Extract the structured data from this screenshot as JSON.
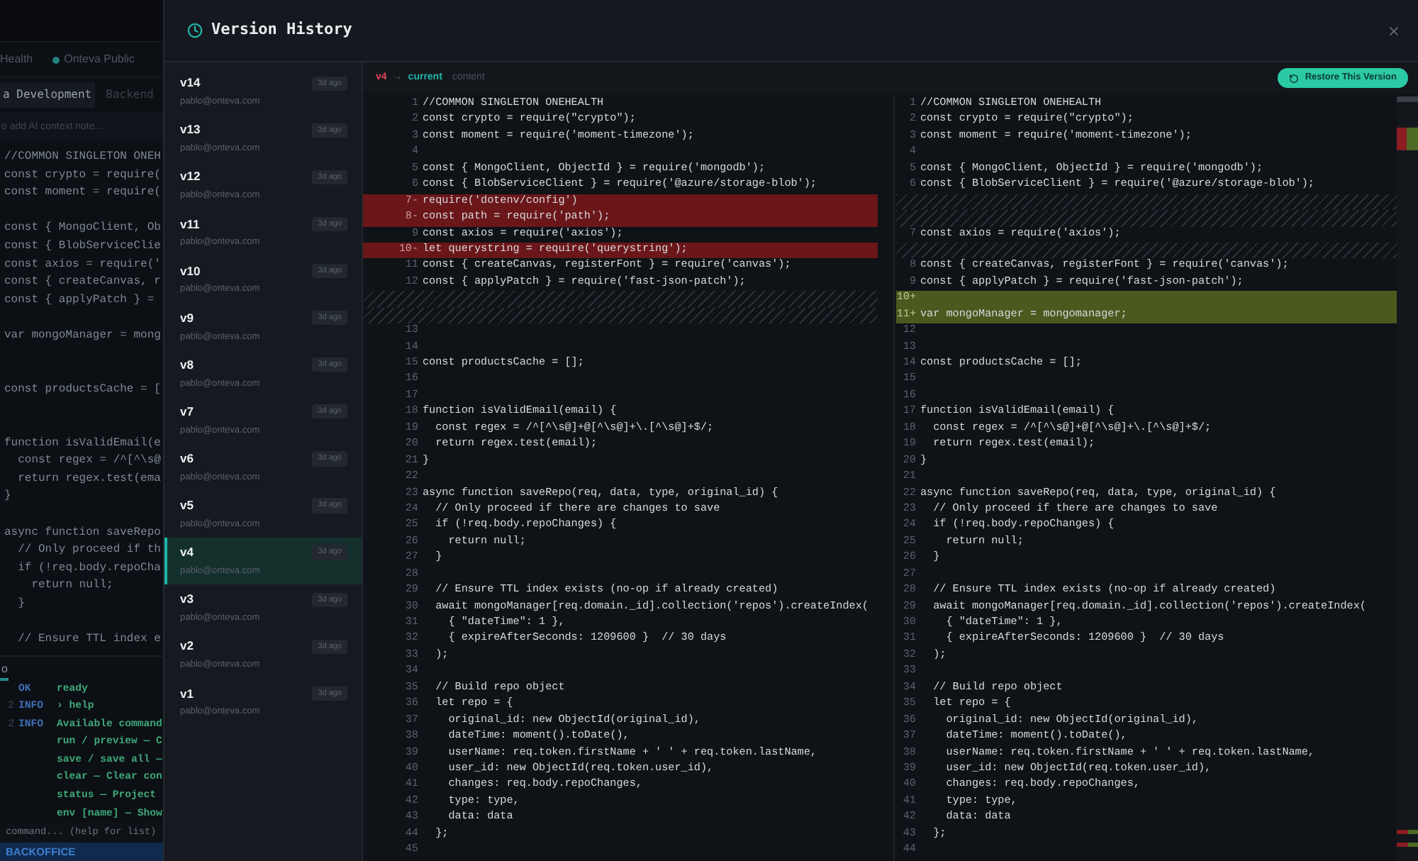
{
  "background_app": {
    "tabs": [
      {
        "label": "Health",
        "dot": false
      },
      {
        "label": "Onteva Public",
        "dot": true
      }
    ],
    "subtabs": [
      {
        "label": "a Development",
        "selected": true
      },
      {
        "label": "Backend",
        "selected": false
      }
    ],
    "note_field": {
      "placeholder": "o add AI context note..."
    },
    "editor_lines": [
      {
        "kind": "code",
        "text": "//COMMON SINGLETON ONEH"
      },
      {
        "kind": "code",
        "text": "const crypto = require("
      },
      {
        "kind": "code",
        "text": "const moment = require("
      },
      {
        "kind": "blank"
      },
      {
        "kind": "code",
        "text": "const { MongoClient, Ob"
      },
      {
        "kind": "code",
        "text": "const { BlobServiceClie"
      },
      {
        "kind": "code",
        "text": "const axios = require('"
      },
      {
        "kind": "code",
        "text": "const { createCanvas, r"
      },
      {
        "kind": "code",
        "text": "const { applyPatch } ="
      },
      {
        "kind": "blank"
      },
      {
        "kind": "code",
        "text": "var mongoManager = mong"
      },
      {
        "kind": "blank"
      },
      {
        "kind": "blank"
      },
      {
        "kind": "code",
        "text": "const productsCache = ["
      },
      {
        "kind": "blank"
      },
      {
        "kind": "blank"
      },
      {
        "kind": "code",
        "text": "function isValidEmail(e"
      },
      {
        "kind": "code",
        "text": "  const regex = /^[^\\s@"
      },
      {
        "kind": "code",
        "text": "  return regex.test(ema"
      },
      {
        "kind": "code",
        "text": "}"
      },
      {
        "kind": "blank"
      },
      {
        "kind": "code",
        "text": "async function saveRepo"
      },
      {
        "kind": "code",
        "text": "  // Only proceed if th"
      },
      {
        "kind": "code",
        "text": "  if (!req.body.repoCha"
      },
      {
        "kind": "code",
        "text": "    return null;"
      },
      {
        "kind": "code",
        "text": "  }"
      },
      {
        "kind": "blank"
      },
      {
        "kind": "code",
        "text": "  // Ensure TTL index e"
      }
    ],
    "terminal_tab": "o",
    "terminal_lines": [
      {
        "level": "OK",
        "text": "ready"
      },
      {
        "number": "2",
        "level": "INFO",
        "text": "› help"
      },
      {
        "number": "2",
        "level": "INFO",
        "text": "Available command"
      },
      {
        "text": "run / preview — C"
      },
      {
        "text": "save / save all —"
      },
      {
        "text": "clear — Clear con"
      },
      {
        "text": "status — Project"
      },
      {
        "text": "env [name] — Show"
      }
    ],
    "command_field": {
      "placeholder": " command... (help for list)"
    },
    "status_bar": "BACKOFFICE"
  },
  "dialog": {
    "title": "Version History",
    "versions": [
      {
        "label": "v14",
        "author": "pablo@onteva.com",
        "age": "3d ago",
        "selected": false
      },
      {
        "label": "v13",
        "author": "pablo@onteva.com",
        "age": "3d ago",
        "selected": false
      },
      {
        "label": "v12",
        "author": "pablo@onteva.com",
        "age": "3d ago",
        "selected": false
      },
      {
        "label": "v11",
        "author": "pablo@onteva.com",
        "age": "3d ago",
        "selected": false
      },
      {
        "label": "v10",
        "author": "pablo@onteva.com",
        "age": "3d ago",
        "selected": false
      },
      {
        "label": "v9",
        "author": "pablo@onteva.com",
        "age": "3d ago",
        "selected": false
      },
      {
        "label": "v8",
        "author": "pablo@onteva.com",
        "age": "3d ago",
        "selected": false
      },
      {
        "label": "v7",
        "author": "pablo@onteva.com",
        "age": "3d ago",
        "selected": false
      },
      {
        "label": "v6",
        "author": "pablo@onteva.com",
        "age": "3d ago",
        "selected": false
      },
      {
        "label": "v5",
        "author": "pablo@onteva.com",
        "age": "3d ago",
        "selected": false
      },
      {
        "label": "v4",
        "author": "pablo@onteva.com",
        "age": "3d ago",
        "selected": true
      },
      {
        "label": "v3",
        "author": "pablo@onteva.com",
        "age": "3d ago",
        "selected": false
      },
      {
        "label": "v2",
        "author": "pablo@onteva.com",
        "age": "3d ago",
        "selected": false
      },
      {
        "label": "v1",
        "author": "pablo@onteva.com",
        "age": "3d ago",
        "selected": false
      }
    ],
    "diff_header": {
      "from": "v4",
      "arrow": "→",
      "to": "current",
      "field": "content"
    },
    "restore_button": "Restore This Version",
    "left_pane": [
      {
        "kind": "normal",
        "number": "1",
        "code": "//COMMON SINGLETON ONEHEALTH"
      },
      {
        "kind": "normal",
        "number": "2",
        "code": "const crypto = require(\"crypto\");"
      },
      {
        "kind": "normal",
        "number": "3",
        "code": "const moment = require('moment-timezone');"
      },
      {
        "kind": "normal",
        "number": "4"
      },
      {
        "kind": "normal",
        "number": "5",
        "code": "const { MongoClient, ObjectId } = require('mongodb');"
      },
      {
        "kind": "normal",
        "number": "6",
        "code": "const { BlobServiceClient } = require('@azure/storage-blob');"
      },
      {
        "kind": "removed",
        "number": "7",
        "sign": "-",
        "code": "require('dotenv/config')"
      },
      {
        "kind": "removed",
        "number": "8",
        "sign": "-",
        "code": "const path = require('path');"
      },
      {
        "kind": "normal",
        "number": "9",
        "code": "const axios = require('axios');"
      },
      {
        "kind": "removed",
        "number": "10",
        "sign": "-",
        "code": "let querystring = require('querystring');"
      },
      {
        "kind": "normal",
        "number": "11",
        "code": "const { createCanvas, registerFont } = require('canvas');"
      },
      {
        "kind": "normal",
        "number": "12",
        "code": "const { applyPatch } = require('fast-json-patch');"
      },
      {
        "kind": "filler"
      },
      {
        "kind": "filler"
      },
      {
        "kind": "normal",
        "number": "13"
      },
      {
        "kind": "normal",
        "number": "14"
      },
      {
        "kind": "normal",
        "number": "15",
        "code": "const productsCache = [];"
      },
      {
        "kind": "normal",
        "number": "16"
      },
      {
        "kind": "normal",
        "number": "17"
      },
      {
        "kind": "normal",
        "number": "18",
        "code": "function isValidEmail(email) {"
      },
      {
        "kind": "normal",
        "number": "19",
        "code": "  const regex = /^[^\\s@]+@[^\\s@]+\\.[^\\s@]+$/;"
      },
      {
        "kind": "normal",
        "number": "20",
        "code": "  return regex.test(email);"
      },
      {
        "kind": "normal",
        "number": "21",
        "code": "}"
      },
      {
        "kind": "normal",
        "number": "22"
      },
      {
        "kind": "normal",
        "number": "23",
        "code": "async function saveRepo(req, data, type, original_id) {"
      },
      {
        "kind": "normal",
        "number": "24",
        "code": "  // Only proceed if there are changes to save"
      },
      {
        "kind": "normal",
        "number": "25",
        "code": "  if (!req.body.repoChanges) {"
      },
      {
        "kind": "normal",
        "number": "26",
        "code": "    return null;"
      },
      {
        "kind": "normal",
        "number": "27",
        "code": "  }"
      },
      {
        "kind": "normal",
        "number": "28"
      },
      {
        "kind": "normal",
        "number": "29",
        "code": "  // Ensure TTL index exists (no-op if already created)"
      },
      {
        "kind": "normal",
        "number": "30",
        "code": "  await mongoManager[req.domain._id].collection('repos').createIndex("
      },
      {
        "kind": "normal",
        "number": "31",
        "code": "    { \"dateTime\": 1 },"
      },
      {
        "kind": "normal",
        "number": "32",
        "code": "    { expireAfterSeconds: 1209600 }  // 30 days"
      },
      {
        "kind": "normal",
        "number": "33",
        "code": "  );"
      },
      {
        "kind": "normal",
        "number": "34"
      },
      {
        "kind": "normal",
        "number": "35",
        "code": "  // Build repo object"
      },
      {
        "kind": "normal",
        "number": "36",
        "code": "  let repo = {"
      },
      {
        "kind": "normal",
        "number": "37",
        "code": "    original_id: new ObjectId(original_id),"
      },
      {
        "kind": "normal",
        "number": "38",
        "code": "    dateTime: moment().toDate(),"
      },
      {
        "kind": "normal",
        "number": "39",
        "code": "    userName: req.token.firstName + ' ' + req.token.lastName,"
      },
      {
        "kind": "normal",
        "number": "40",
        "code": "    user_id: new ObjectId(req.token.user_id),"
      },
      {
        "kind": "normal",
        "number": "41",
        "code": "    changes: req.body.repoChanges,"
      },
      {
        "kind": "normal",
        "number": "42",
        "code": "    type: type,"
      },
      {
        "kind": "normal",
        "number": "43",
        "code": "    data: data"
      },
      {
        "kind": "normal",
        "number": "44",
        "code": "  };"
      },
      {
        "kind": "normal",
        "number": "45"
      }
    ],
    "right_pane": [
      {
        "kind": "normal",
        "number": "1",
        "code": "//COMMON SINGLETON ONEHEALTH"
      },
      {
        "kind": "normal",
        "number": "2",
        "code": "const crypto = require(\"crypto\");"
      },
      {
        "kind": "normal",
        "number": "3",
        "code": "const moment = require('moment-timezone');"
      },
      {
        "kind": "normal",
        "number": "4"
      },
      {
        "kind": "normal",
        "number": "5",
        "code": "const { MongoClient, ObjectId } = require('mongodb');"
      },
      {
        "kind": "normal",
        "number": "6",
        "code": "const { BlobServiceClient } = require('@azure/storage-blob');"
      },
      {
        "kind": "filler"
      },
      {
        "kind": "filler"
      },
      {
        "kind": "normal",
        "number": "7",
        "code": "const axios = require('axios');"
      },
      {
        "kind": "filler"
      },
      {
        "kind": "normal",
        "number": "8",
        "code": "const { createCanvas, registerFont } = require('canvas');"
      },
      {
        "kind": "normal",
        "number": "9",
        "code": "const { applyPatch } = require('fast-json-patch');"
      },
      {
        "kind": "added",
        "number": "10",
        "sign": "+"
      },
      {
        "kind": "added",
        "number": "11",
        "sign": "+",
        "code": "var mongoManager = mongomanager;"
      },
      {
        "kind": "normal",
        "number": "12"
      },
      {
        "kind": "normal",
        "number": "13"
      },
      {
        "kind": "normal",
        "number": "14",
        "code": "const productsCache = [];"
      },
      {
        "kind": "normal",
        "number": "15"
      },
      {
        "kind": "normal",
        "number": "16"
      },
      {
        "kind": "normal",
        "number": "17",
        "code": "function isValidEmail(email) {"
      },
      {
        "kind": "normal",
        "number": "18",
        "code": "  const regex = /^[^\\s@]+@[^\\s@]+\\.[^\\s@]+$/;"
      },
      {
        "kind": "normal",
        "number": "19",
        "code": "  return regex.test(email);"
      },
      {
        "kind": "normal",
        "number": "20",
        "code": "}"
      },
      {
        "kind": "normal",
        "number": "21"
      },
      {
        "kind": "normal",
        "number": "22",
        "code": "async function saveRepo(req, data, type, original_id) {"
      },
      {
        "kind": "normal",
        "number": "23",
        "code": "  // Only proceed if there are changes to save"
      },
      {
        "kind": "normal",
        "number": "24",
        "code": "  if (!req.body.repoChanges) {"
      },
      {
        "kind": "normal",
        "number": "25",
        "code": "    return null;"
      },
      {
        "kind": "normal",
        "number": "26",
        "code": "  }"
      },
      {
        "kind": "normal",
        "number": "27"
      },
      {
        "kind": "normal",
        "number": "28",
        "code": "  // Ensure TTL index exists (no-op if already created)"
      },
      {
        "kind": "normal",
        "number": "29",
        "code": "  await mongoManager[req.domain._id].collection('repos').createIndex("
      },
      {
        "kind": "normal",
        "number": "30",
        "code": "    { \"dateTime\": 1 },"
      },
      {
        "kind": "normal",
        "number": "31",
        "code": "    { expireAfterSeconds: 1209600 }  // 30 days"
      },
      {
        "kind": "normal",
        "number": "32",
        "code": "  );"
      },
      {
        "kind": "normal",
        "number": "33"
      },
      {
        "kind": "normal",
        "number": "34",
        "code": "  // Build repo object"
      },
      {
        "kind": "normal",
        "number": "35",
        "code": "  let repo = {"
      },
      {
        "kind": "normal",
        "number": "36",
        "code": "    original_id: new ObjectId(original_id),"
      },
      {
        "kind": "normal",
        "number": "37",
        "code": "    dateTime: moment().toDate(),"
      },
      {
        "kind": "normal",
        "number": "38",
        "code": "    userName: req.token.firstName + ' ' + req.token.lastName,"
      },
      {
        "kind": "normal",
        "number": "39",
        "code": "    user_id: new ObjectId(req.token.user_id),"
      },
      {
        "kind": "normal",
        "number": "40",
        "code": "    changes: req.body.repoChanges,"
      },
      {
        "kind": "normal",
        "number": "41",
        "code": "    type: type,"
      },
      {
        "kind": "normal",
        "number": "42",
        "code": "    data: data"
      },
      {
        "kind": "normal",
        "number": "43",
        "code": "  };"
      },
      {
        "kind": "normal",
        "number": "44"
      }
    ]
  }
}
